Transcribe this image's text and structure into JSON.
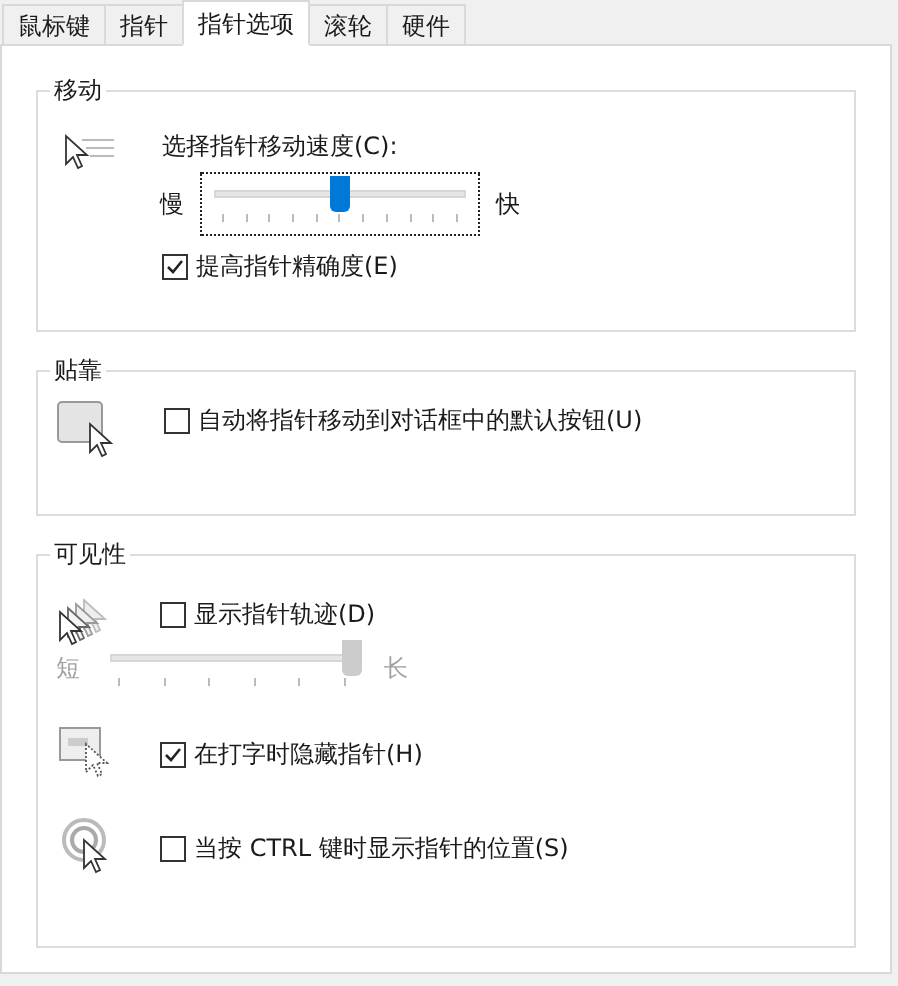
{
  "tabs": [
    {
      "label": "鼠标键",
      "selected": false
    },
    {
      "label": "指针",
      "selected": false
    },
    {
      "label": "指针选项",
      "selected": true
    },
    {
      "label": "滚轮",
      "selected": false
    },
    {
      "label": "硬件",
      "selected": false
    }
  ],
  "motion": {
    "title": "移动",
    "speed_label": "选择指针移动速度(C):",
    "speed": {
      "min_label": "慢",
      "max_label": "快",
      "level": 0.5,
      "focused": true,
      "disabled": false
    },
    "precision": {
      "label": "提高指针精确度(E)",
      "checked": true
    }
  },
  "snap": {
    "title": "贴靠",
    "option": {
      "label": "自动将指针移动到对话框中的默认按钮(U)",
      "checked": false
    }
  },
  "visibility": {
    "title": "可见性",
    "trails": {
      "label": "显示指针轨迹(D)",
      "checked": false
    },
    "trail_length": {
      "min_label": "短",
      "max_label": "长",
      "level": 1,
      "focused": false,
      "disabled": true
    },
    "hide_typing": {
      "label": "在打字时隐藏指针(H)",
      "checked": true
    },
    "ctrl_locate": {
      "label": "当按 CTRL 键时显示指针的位置(S)",
      "checked": false
    }
  }
}
